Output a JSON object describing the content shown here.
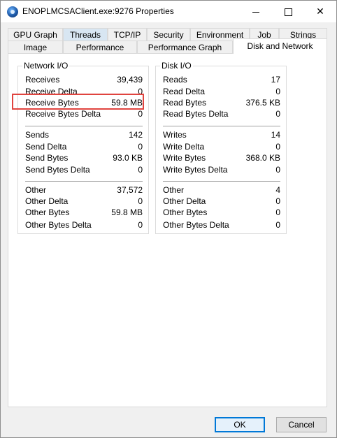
{
  "window": {
    "title": "ENOPLMCSAClient.exe:9276 Properties",
    "icon": "process-hacker-icon",
    "controls": {
      "minimize": "minimize-icon",
      "maximize": "maximize-icon",
      "close": "✕"
    }
  },
  "tabs_row1": [
    "GPU Graph",
    "Threads",
    "TCP/IP",
    "Security",
    "Environment",
    "Job",
    "Strings"
  ],
  "tabs_row2": [
    "Image",
    "Performance",
    "Performance Graph",
    "Disk and Network"
  ],
  "active_tab": "Disk and Network",
  "network": {
    "title": "Network I/O",
    "receives_label": "Receives",
    "receives_value": "39,439",
    "receive_delta_label": "Receive Delta",
    "receive_delta_value": "0",
    "receive_bytes_label": "Receive Bytes",
    "receive_bytes_value": "59.8  MB",
    "receive_bytes_delta_label": "Receive Bytes Delta",
    "receive_bytes_delta_value": "0",
    "sends_label": "Sends",
    "sends_value": "142",
    "send_delta_label": "Send Delta",
    "send_delta_value": "0",
    "send_bytes_label": "Send Bytes",
    "send_bytes_value": "93.0  KB",
    "send_bytes_delta_label": "Send Bytes Delta",
    "send_bytes_delta_value": "0",
    "other_label": "Other",
    "other_value": "37,572",
    "other_delta_label": "Other Delta",
    "other_delta_value": "0",
    "other_bytes_label": "Other Bytes",
    "other_bytes_value": "59.8  MB",
    "other_bytes_delta_label": "Other Bytes Delta",
    "other_bytes_delta_value": "0"
  },
  "disk": {
    "title": "Disk I/O",
    "reads_label": "Reads",
    "reads_value": "17",
    "read_delta_label": "Read Delta",
    "read_delta_value": "0",
    "read_bytes_label": "Read Bytes",
    "read_bytes_value": "376.5  KB",
    "read_bytes_delta_label": "Read Bytes Delta",
    "read_bytes_delta_value": "0",
    "writes_label": "Writes",
    "writes_value": "14",
    "write_delta_label": "Write Delta",
    "write_delta_value": "0",
    "write_bytes_label": "Write Bytes",
    "write_bytes_value": "368.0  KB",
    "write_bytes_delta_label": "Write Bytes Delta",
    "write_bytes_delta_value": "0",
    "other_label": "Other",
    "other_value": "4",
    "other_delta_label": "Other Delta",
    "other_delta_value": "0",
    "other_bytes_label": "Other Bytes",
    "other_bytes_value": "0",
    "other_bytes_delta_label": "Other Bytes Delta",
    "other_bytes_delta_value": "0"
  },
  "buttons": {
    "ok": "OK",
    "cancel": "Cancel"
  },
  "colors": {
    "highlight": "#e0443f",
    "default_button_border": "#0078d7"
  }
}
